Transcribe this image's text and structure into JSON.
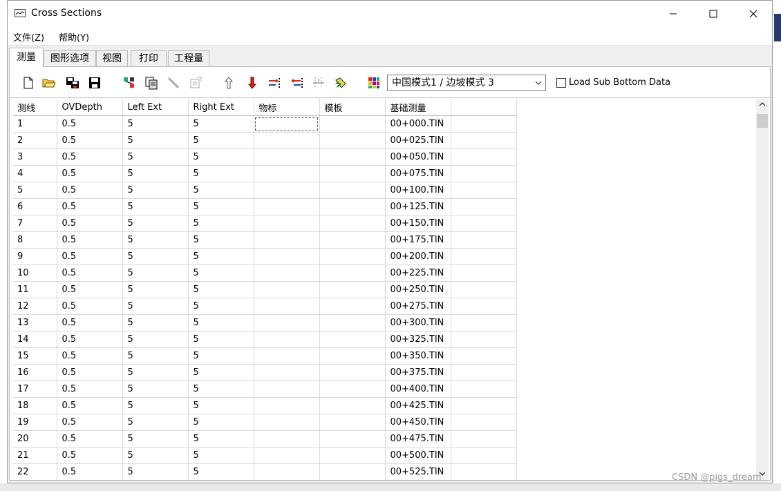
{
  "window": {
    "title": "Cross Sections",
    "controls": {
      "minimize": "—",
      "maximize": "☐",
      "close": "✕"
    }
  },
  "menu": [
    {
      "label": "文件(Z)"
    },
    {
      "label": "帮助(Y)"
    }
  ],
  "tabs": [
    {
      "label": "测量",
      "active": true
    },
    {
      "label": "图形选项",
      "active": false
    },
    {
      "label": "视图",
      "active": false
    },
    {
      "label": "打印",
      "active": false
    },
    {
      "label": "工程量",
      "active": false
    }
  ],
  "toolbar": {
    "icons": [
      "new-file-icon",
      "open-folder-icon",
      "save-as-icon",
      "save-icon",
      "node-icon",
      "copy-icon",
      "pencil-icon",
      "properties-icon",
      "arrow-up-icon",
      "arrow-down-icon",
      "insert-right-icon",
      "insert-left-icon",
      "align-icon",
      "edit-pen-icon",
      "palette-icon"
    ],
    "mode_select": "中国模式1 / 边坡模式 3",
    "load_sub_bottom": {
      "label": "Load Sub Bottom Data",
      "checked": false
    }
  },
  "grid": {
    "columns": [
      "测线",
      "OVDepth",
      "Left Ext",
      "Right Ext",
      "物标",
      "模板",
      "基础测量",
      ""
    ],
    "rows": [
      [
        "1",
        "0.5",
        "5",
        "5",
        "",
        "",
        "00+000.TIN",
        ""
      ],
      [
        "2",
        "0.5",
        "5",
        "5",
        "",
        "",
        "00+025.TIN",
        ""
      ],
      [
        "3",
        "0.5",
        "5",
        "5",
        "",
        "",
        "00+050.TIN",
        ""
      ],
      [
        "4",
        "0.5",
        "5",
        "5",
        "",
        "",
        "00+075.TIN",
        ""
      ],
      [
        "5",
        "0.5",
        "5",
        "5",
        "",
        "",
        "00+100.TIN",
        ""
      ],
      [
        "6",
        "0.5",
        "5",
        "5",
        "",
        "",
        "00+125.TIN",
        ""
      ],
      [
        "7",
        "0.5",
        "5",
        "5",
        "",
        "",
        "00+150.TIN",
        ""
      ],
      [
        "8",
        "0.5",
        "5",
        "5",
        "",
        "",
        "00+175.TIN",
        ""
      ],
      [
        "9",
        "0.5",
        "5",
        "5",
        "",
        "",
        "00+200.TIN",
        ""
      ],
      [
        "10",
        "0.5",
        "5",
        "5",
        "",
        "",
        "00+225.TIN",
        ""
      ],
      [
        "11",
        "0.5",
        "5",
        "5",
        "",
        "",
        "00+250.TIN",
        ""
      ],
      [
        "12",
        "0.5",
        "5",
        "5",
        "",
        "",
        "00+275.TIN",
        ""
      ],
      [
        "13",
        "0.5",
        "5",
        "5",
        "",
        "",
        "00+300.TIN",
        ""
      ],
      [
        "14",
        "0.5",
        "5",
        "5",
        "",
        "",
        "00+325.TIN",
        ""
      ],
      [
        "15",
        "0.5",
        "5",
        "5",
        "",
        "",
        "00+350.TIN",
        ""
      ],
      [
        "16",
        "0.5",
        "5",
        "5",
        "",
        "",
        "00+375.TIN",
        ""
      ],
      [
        "17",
        "0.5",
        "5",
        "5",
        "",
        "",
        "00+400.TIN",
        ""
      ],
      [
        "18",
        "0.5",
        "5",
        "5",
        "",
        "",
        "00+425.TIN",
        ""
      ],
      [
        "19",
        "0.5",
        "5",
        "5",
        "",
        "",
        "00+450.TIN",
        ""
      ],
      [
        "20",
        "0.5",
        "5",
        "5",
        "",
        "",
        "00+475.TIN",
        ""
      ],
      [
        "21",
        "0.5",
        "5",
        "5",
        "",
        "",
        "00+500.TIN",
        ""
      ],
      [
        "22",
        "0.5",
        "5",
        "5",
        "",
        "",
        "00+525.TIN",
        ""
      ],
      [
        "",
        "",
        "",
        "",
        "",
        "",
        "",
        ""
      ]
    ]
  },
  "watermark": "CSDN @pigs_dream"
}
